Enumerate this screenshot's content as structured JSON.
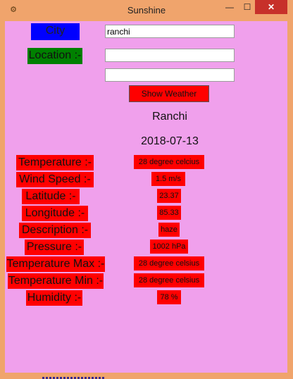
{
  "window": {
    "title": "Sunshine",
    "controls": {
      "minimize": "—",
      "maximize": "☐",
      "close": "✕"
    }
  },
  "form": {
    "city_label": "City",
    "location_label": "Location :-",
    "city_value": "ranchi",
    "location_value": "",
    "extra_value": "",
    "button_label": "Show Weather"
  },
  "result": {
    "city": "Ranchi",
    "date": "2018-07-13",
    "rows": [
      {
        "label": "Temperature :-",
        "value": "28 degree celcius"
      },
      {
        "label": "Wind Speed :-",
        "value": "1.5 m/s"
      },
      {
        "label": "Latitude :-",
        "value": "23.37"
      },
      {
        "label": "Longitude :-",
        "value": "85.33"
      },
      {
        "label": "Description :-",
        "value": "haze"
      },
      {
        "label": "Pressure :-",
        "value": "1002 hPa"
      },
      {
        "label": "Temperature Max :-",
        "value": "28 degree celsius"
      },
      {
        "label": "Temperature Min :-",
        "value": "28 degree celsius"
      },
      {
        "label": "Humidity :-",
        "value": "78 %"
      }
    ]
  },
  "colors": {
    "client_bg": "#f0a0ec",
    "frame": "#f0a46c",
    "label_red": "#ff0000",
    "city_blue": "#0000ff",
    "location_green": "#008000"
  },
  "icons": {
    "app": "app-icon"
  }
}
